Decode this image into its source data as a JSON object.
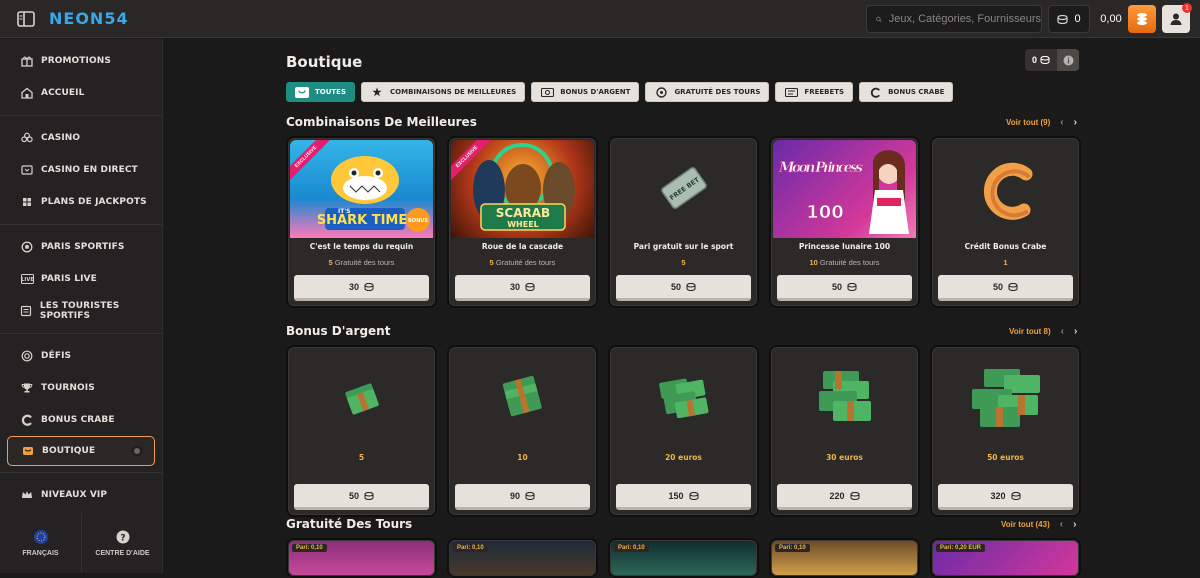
{
  "header": {
    "logo": "NEON",
    "logo_num": "54",
    "search_placeholder": "Jeux, Catégories, Fournisseurs",
    "coins": "0",
    "balance": "0,00",
    "notif_count": "1"
  },
  "sidebar": {
    "groups": [
      [
        {
          "label": "Promotions",
          "icon": "gift-icon"
        },
        {
          "label": "Accueil",
          "icon": "home-icon"
        }
      ],
      [
        {
          "label": "Casino",
          "icon": "club-icon"
        },
        {
          "label": "Casino en direct",
          "icon": "live-cards-icon"
        },
        {
          "label": "Plans de jackpots",
          "icon": "jackpot-icon"
        }
      ],
      [
        {
          "label": "Paris sportifs",
          "icon": "ball-icon"
        },
        {
          "label": "Paris live",
          "icon": "live-icon"
        },
        {
          "label": "Les touristes sportifs",
          "icon": "ticket-icon"
        }
      ],
      [
        {
          "label": "Défis",
          "icon": "target-icon"
        },
        {
          "label": "Tournois",
          "icon": "trophy-icon"
        },
        {
          "label": "Bonus crabe",
          "icon": "crab-icon"
        },
        {
          "label": "Boutique",
          "icon": "shop-icon",
          "active": true
        }
      ],
      [
        {
          "label": "Niveaux VIP",
          "icon": "crown-icon"
        }
      ]
    ],
    "footer": {
      "language": "FRANÇAIS",
      "help": "CENTRE D'AIDE"
    }
  },
  "page": {
    "title": "Boutique",
    "wallet_amount": "0"
  },
  "filters": [
    {
      "label": "Toutes",
      "active": true
    },
    {
      "label": "Combinaisons de meilleures"
    },
    {
      "label": "Bonus d'argent"
    },
    {
      "label": "Gratuité des tours"
    },
    {
      "label": "Freebets"
    },
    {
      "label": "Bonus crabe"
    }
  ],
  "sections": {
    "combos": {
      "title": "Combinaisons De Meilleures",
      "see_all": "Voir tout (9)",
      "cards": [
        {
          "name": "C'est le temps du requin",
          "qty": "5",
          "qty_label": "Gratuité des tours",
          "price": "30",
          "exclusive": "EXCLUSIVE",
          "art_title": "SHARK TIME!",
          "art_sub": "IT'S",
          "art_badge": "BONUS"
        },
        {
          "name": "Roue de la cascade",
          "qty": "5",
          "qty_label": "Gratuité des tours",
          "price": "30",
          "exclusive": "EXCLUSIVE",
          "art_title": "SCARAB",
          "art_sub": "WHEEL"
        },
        {
          "name": "Pari gratuit sur le sport",
          "qty": "5",
          "qty_label": "",
          "price": "50",
          "art_title": "FREE BET"
        },
        {
          "name": "Princesse lunaire 100",
          "qty": "10",
          "qty_label": "Gratuité des tours",
          "price": "50",
          "art_title": "Moon Princess",
          "art_sub": "100"
        },
        {
          "name": "Crédit Bonus Crabe",
          "qty": "1",
          "qty_label": "",
          "price": "50"
        }
      ]
    },
    "money": {
      "title": "Bonus D'argent",
      "see_all": "Voir tout 8)",
      "cards": [
        {
          "name": "5",
          "price": "50"
        },
        {
          "name": "10",
          "price": "90"
        },
        {
          "name": "20 euros",
          "price": "150"
        },
        {
          "name": "30 euros",
          "price": "220"
        },
        {
          "name": "50 euros",
          "price": "320"
        }
      ]
    },
    "spins": {
      "title": "Gratuité Des Tours",
      "see_all": "Voir tout (43)",
      "cards": [
        {
          "bet": "Pari: 0,10"
        },
        {
          "bet": "Pari: 0,10"
        },
        {
          "bet": "Pari: 0,10"
        },
        {
          "bet": "Pari: 0,10"
        },
        {
          "bet": "Pari: 0,20 EUR"
        }
      ]
    }
  },
  "colors": {
    "accent": "#f0a040",
    "teal": "#1e8d83",
    "bg": "#1b1a1a"
  }
}
